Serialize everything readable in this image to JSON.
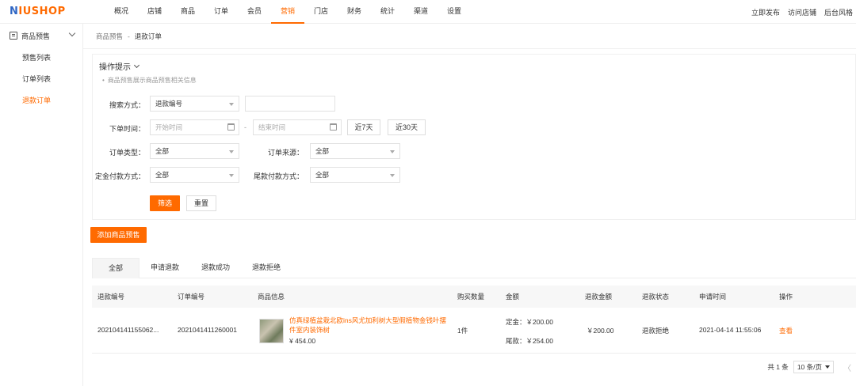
{
  "logo": {
    "prefix": "N",
    "rest": "IUSHOP"
  },
  "topnav": [
    "概况",
    "店铺",
    "商品",
    "订单",
    "会员",
    "营销",
    "门店",
    "财务",
    "统计",
    "渠道",
    "设置"
  ],
  "topright": [
    "立即发布",
    "访问店铺",
    "后台风格"
  ],
  "sidebar": {
    "section": "商品预售",
    "items": [
      "预售列表",
      "订单列表",
      "退款订单"
    ]
  },
  "breadcrumb": {
    "parent": "商品预售",
    "sep": "-",
    "current": "退款订单"
  },
  "tips": {
    "title": "操作提示",
    "desc": "商品预售展示商品预售相关信息"
  },
  "filter": {
    "search_label": "搜索方式：",
    "search_type": "退款编号",
    "search_value": "",
    "order_time_label": "下单时间：",
    "start_placeholder": "开始时间",
    "end_placeholder": "结束时间",
    "dash": "-",
    "btn_7days": "近7天",
    "btn_30days": "近30天",
    "order_type_label": "订单类型：",
    "order_type": "全部",
    "order_source_label": "订单来源：",
    "order_source": "全部",
    "deposit_pay_label": "定金付款方式：",
    "deposit_pay": "全部",
    "final_pay_label": "尾款付款方式：",
    "final_pay": "全部",
    "btn_filter": "筛选",
    "btn_reset": "重置"
  },
  "add_button": "添加商品预售",
  "tabs": [
    "全部",
    "申请退款",
    "退款成功",
    "退款拒绝"
  ],
  "table": {
    "headers": [
      "退款编号",
      "订单编号",
      "商品信息",
      "购买数量",
      "金额",
      "退款金额",
      "退款状态",
      "申请时间",
      "操作"
    ],
    "rows": [
      {
        "refund_no": "202104141155062...",
        "order_no": "2021041411260001",
        "goods_name": "仿真绿植盆栽北欧ins风尤加利树大型假植物金钱叶摆件室内装饰树",
        "goods_price": "¥ 454.00",
        "qty": "1件",
        "deposit": "定金：￥200.00",
        "final": "尾款：￥254.00",
        "refund_amount": "￥200.00",
        "status": "退款拒绝",
        "apply_time": "2021-04-14 11:55:06",
        "action": "查看"
      }
    ]
  },
  "pager": {
    "total": "共 1 条",
    "page_size": "10 条/页",
    "prev": "〈"
  },
  "colors": {
    "accent": "#ff6a00",
    "logo_blue": "#2f66c4"
  }
}
